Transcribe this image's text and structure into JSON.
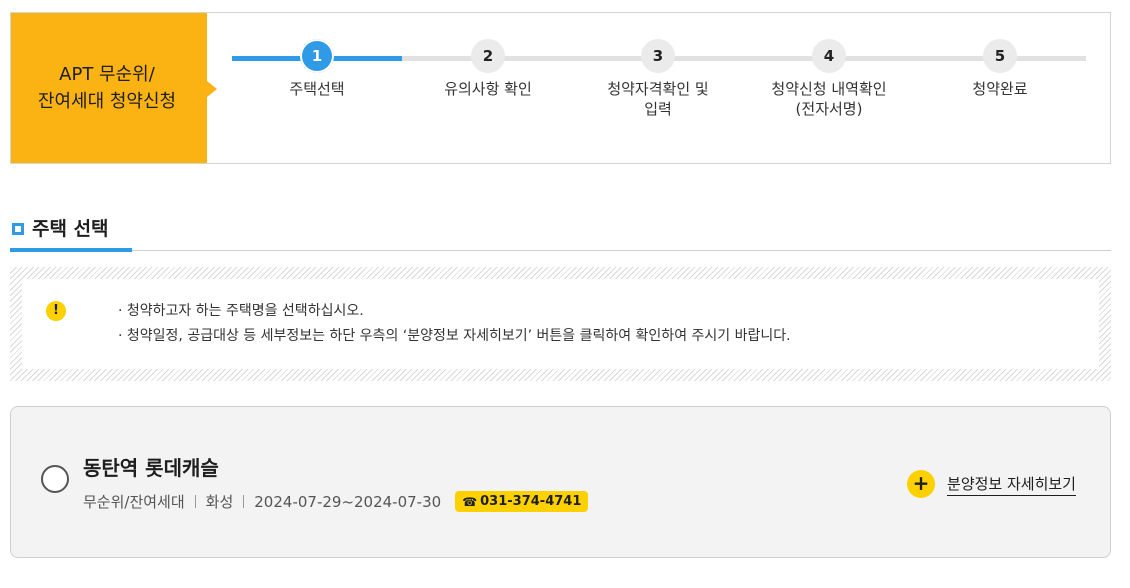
{
  "stepper": {
    "title": "APT 무순위/\n잔여세대 청약신청",
    "current_step": 1,
    "steps": [
      {
        "num": "1",
        "label": "주택선택"
      },
      {
        "num": "2",
        "label": "유의사항 확인"
      },
      {
        "num": "3",
        "label": "청약자격확인 및\n입력"
      },
      {
        "num": "4",
        "label": "청약신청 내역확인\n(전자서명)"
      },
      {
        "num": "5",
        "label": "청약완료"
      }
    ]
  },
  "section": {
    "title": "주택 선택"
  },
  "notice": {
    "icon": "exclamation-icon",
    "items": [
      "· 청약하고자 하는 주택명을 선택하십시오.",
      "· 청약일정, 공급대상 등 세부정보는 하단 우측의 ‘분양정보 자세히보기’ 버튼을 클릭하여 확인하여 주시기 바랍니다."
    ]
  },
  "house": {
    "name": "동탄역 롯데캐슬",
    "type": "무순위/잔여세대",
    "region": "화성",
    "period": "2024-07-29~2024-07-30",
    "tel": "031-374-4741",
    "detail_label": "분양정보 자세히보기"
  },
  "colors": {
    "accent": "#2f9be6",
    "brand_yellow": "#fbb313",
    "badge_yellow": "#fdd000"
  }
}
